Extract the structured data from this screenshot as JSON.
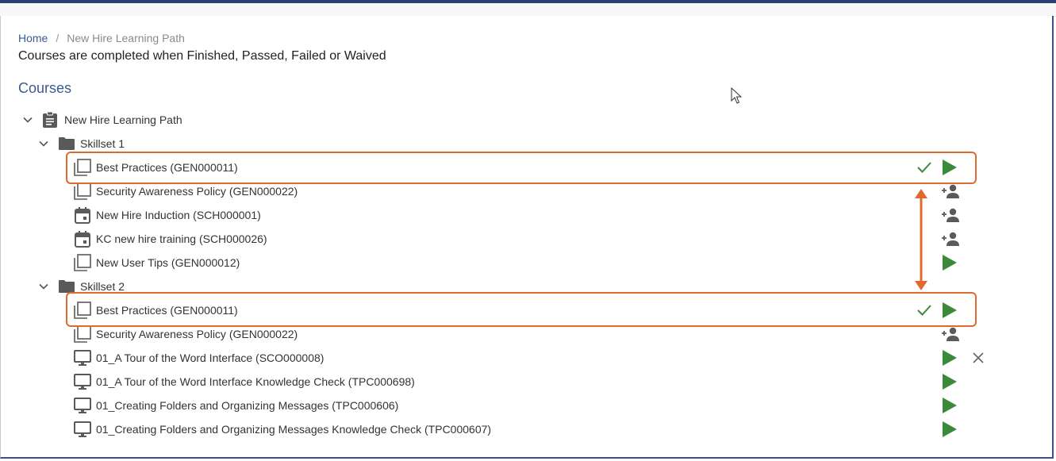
{
  "breadcrumb": {
    "home": "Home",
    "separator": "/",
    "current": "New Hire Learning Path"
  },
  "description": "Courses are completed when Finished, Passed, Failed or Waived",
  "section_title": "Courses",
  "tree": {
    "root": {
      "label": "New Hire Learning Path",
      "icon": "clipboard-icon"
    },
    "skillset1": {
      "label": "Skillset 1",
      "icon": "folder-icon",
      "items": [
        {
          "label": "Best Practices (GEN000011)",
          "icon": "course-stack-icon",
          "status": "completed"
        },
        {
          "label": "Security Awareness Policy (GEN000022)",
          "icon": "course-stack-icon",
          "status": "enroll"
        },
        {
          "label": "New Hire Induction (SCH000001)",
          "icon": "calendar-icon",
          "status": "enroll"
        },
        {
          "label": "KC new hire training (SCH000026)",
          "icon": "calendar-icon",
          "status": "enroll"
        },
        {
          "label": "New User Tips (GEN000012)",
          "icon": "course-stack-icon",
          "status": "launch"
        }
      ]
    },
    "skillset2": {
      "label": "Skillset 2",
      "icon": "folder-icon",
      "items": [
        {
          "label": "Best Practices (GEN000011)",
          "icon": "course-stack-icon",
          "status": "completed"
        },
        {
          "label": "Security Awareness Policy (GEN000022)",
          "icon": "course-stack-icon",
          "status": "enroll"
        },
        {
          "label": "01_A Tour of the Word Interface (SCO000008)",
          "icon": "monitor-icon",
          "status": "launch-remove"
        },
        {
          "label": "01_A Tour of the Word Interface Knowledge Check (TPC000698)",
          "icon": "monitor-icon",
          "status": "launch"
        },
        {
          "label": "01_Creating Folders and Organizing Messages (TPC000606)",
          "icon": "monitor-icon",
          "status": "launch"
        },
        {
          "label": "01_Creating Folders and Organizing Messages Knowledge Check (TPC000607)",
          "icon": "monitor-icon",
          "status": "launch"
        }
      ]
    }
  },
  "colors": {
    "accent": "#3a5b8f",
    "play": "#3a8a3a",
    "check": "#3a8a3a",
    "highlight": "#e1692f",
    "icon": "#5a5a5a"
  }
}
